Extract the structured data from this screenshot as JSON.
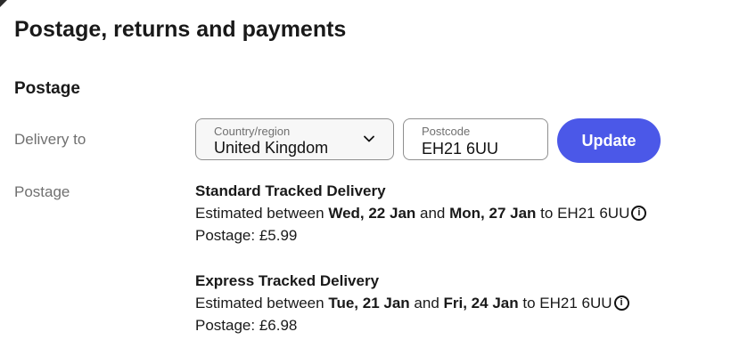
{
  "page": {
    "title": "Postage, returns and payments",
    "section_title": "Postage"
  },
  "delivery": {
    "label": "Delivery to",
    "country_label": "Country/region",
    "country_value": "United Kingdom",
    "postcode_label": "Postcode",
    "postcode_value": "EH21 6UU",
    "update_label": "Update"
  },
  "postage": {
    "label": "Postage",
    "options": [
      {
        "name": "Standard Tracked Delivery",
        "estimate_prefix": "Estimated between",
        "start_date": "Wed, 22 Jan",
        "and_text": "and",
        "end_date": "Mon, 27 Jan",
        "destination_prefix": "to",
        "destination": "EH21 6UU",
        "price_label": "Postage:",
        "price": "£5.99"
      },
      {
        "name": "Express Tracked Delivery",
        "estimate_prefix": "Estimated between",
        "start_date": "Tue, 21 Jan",
        "and_text": "and",
        "end_date": "Fri, 24 Jan",
        "destination_prefix": "to",
        "destination": "EH21 6UU",
        "price_label": "Postage:",
        "price": "£6.98"
      }
    ]
  },
  "icons": {
    "info": "i",
    "dropdown": "chevron-down-icon",
    "info_icon": "info-icon"
  },
  "colors": {
    "accent": "#4b58e8",
    "text": "#191919",
    "muted": "#707070",
    "field_border": "#8f8f8f"
  }
}
